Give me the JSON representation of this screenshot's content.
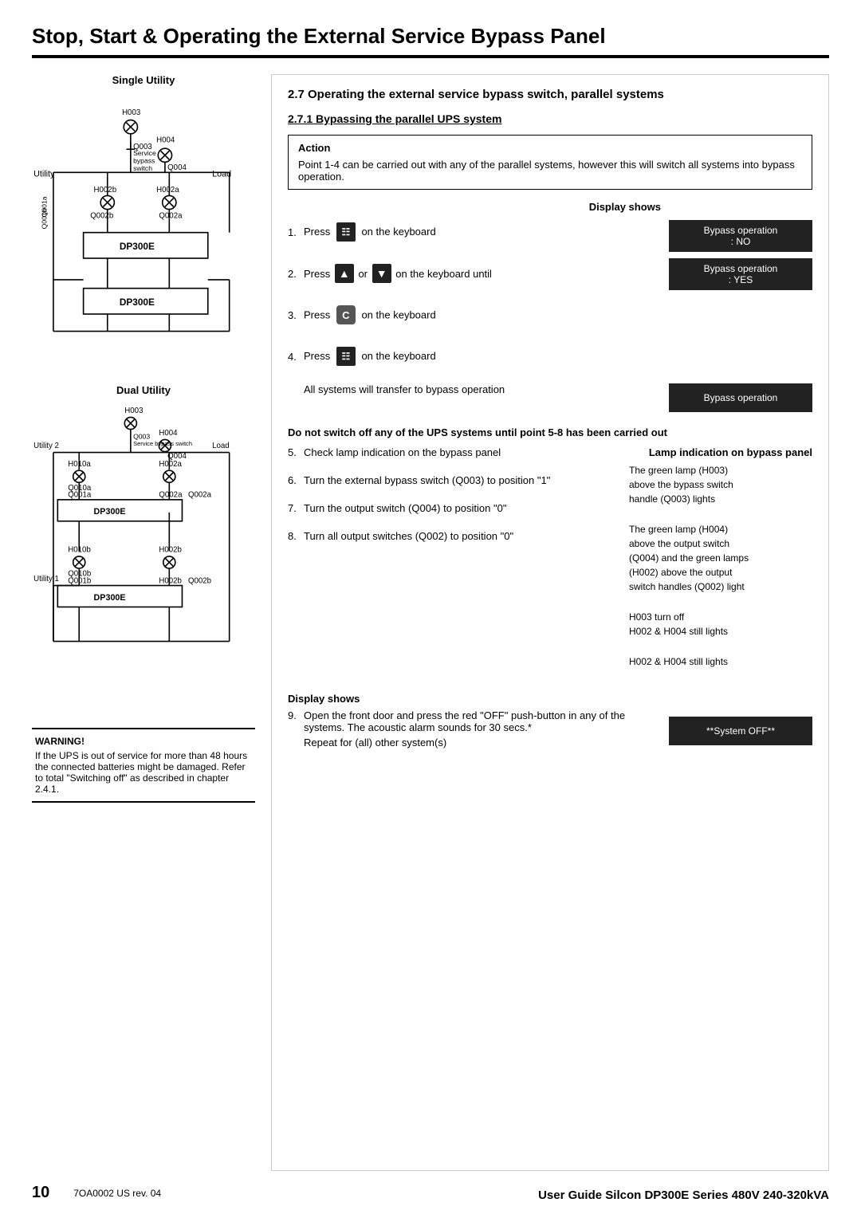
{
  "page": {
    "title": "Stop, Start & Operating the External Service Bypass Panel",
    "footer_page_num": "10",
    "footer_doc": "7OA0002 US rev. 04",
    "footer_right": "User Guide Silcon DP300E Series 480V 240-320kVA"
  },
  "left_column": {
    "single_utility_label": "Single Utility",
    "dual_utility_label": "Dual Utility",
    "warning": {
      "title": "WARNING!",
      "text": "If the UPS is out of service for more than 48 hours the connected batteries might be damaged. Refer to total \"Switching off\" as described in chapter 2.4.1."
    }
  },
  "right_column": {
    "section_2_7_heading": "2.7   Operating the external service bypass switch, parallel systems",
    "section_2_7_1_heading": "2.7.1   Bypassing the parallel UPS system",
    "action_title": "Action",
    "action_text": "Point 1-4 can be carried out with any of the parallel systems, however this will switch all systems into bypass operation.",
    "display_shows_label": "Display shows",
    "steps": [
      {
        "num": "1.",
        "text_prefix": "Press",
        "icon": "menu",
        "text_suffix": "on the keyboard"
      },
      {
        "num": "2.",
        "text_prefix": "Press",
        "icon": "arrow_up_down",
        "text_suffix": "on the keyboard until"
      },
      {
        "num": "3.",
        "text_prefix": "Press",
        "icon": "C",
        "text_suffix": "on the keyboard"
      },
      {
        "num": "4.",
        "text_prefix": "Press",
        "icon": "menu",
        "text_suffix": "on the keyboard"
      }
    ],
    "display_boxes_1_2": [
      "Bypass operation\n: NO",
      "Bypass operation\n: YES"
    ],
    "step4_text": "All systems will transfer to bypass operation",
    "display_box_4": "Bypass operation",
    "bold_warning": "Do not switch off any of the UPS systems until point 5-8 has been carried out",
    "lamp_indication_label": "Lamp indication\non bypass panel",
    "lamp_steps": [
      {
        "num": "5.",
        "text": "Check lamp indication on the bypass panel",
        "desc": "The green lamp (H003)\nabove the bypass switch\nhandle (Q003) lights"
      },
      {
        "num": "6.",
        "text": "Turn the external bypass switch (Q003) to position \"1\"",
        "desc": "The green lamp (H004)\nabove the output switch\n(Q004) and the green lamps\n(H002) above the output\nswitch handles (Q002) light"
      },
      {
        "num": "7.",
        "text": "Turn the output switch (Q004) to position \"0\"",
        "desc": "H003 turn off\nH002 & H004 still lights"
      },
      {
        "num": "8.",
        "text": "Turn all output switches (Q002) to position \"0\"",
        "desc": "H002 & H004 still lights"
      }
    ],
    "display_shows_bottom_label": "Display shows",
    "step9_num": "9.",
    "step9_text": "Open the front door and press the red \"OFF\" push-button in any of the systems. The acoustic alarm sounds for 30 secs.*",
    "step9_repeat": "Repeat for (all) other system(s)",
    "display_box_9": "**System OFF**"
  }
}
